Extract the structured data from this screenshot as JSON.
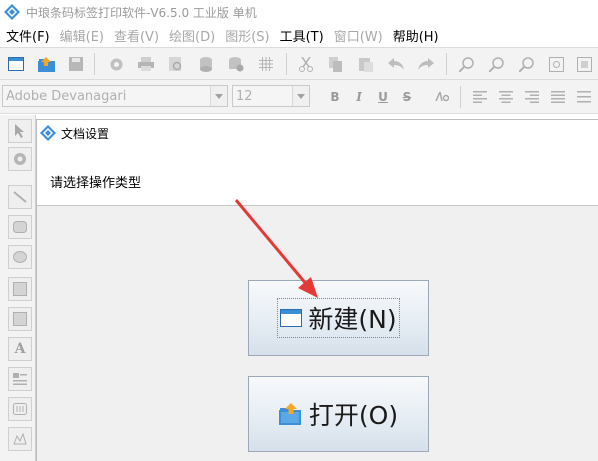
{
  "app": {
    "title": "中琅条码标签打印软件-V6.5.0 工业版 单机",
    "logo_icon": "diamond-logo-icon"
  },
  "menu": [
    {
      "label": "文件(F)",
      "enabled": true
    },
    {
      "label": "编辑(E)",
      "enabled": false
    },
    {
      "label": "查看(V)",
      "enabled": false
    },
    {
      "label": "绘图(D)",
      "enabled": false
    },
    {
      "label": "图形(S)",
      "enabled": false
    },
    {
      "label": "工具(T)",
      "enabled": true
    },
    {
      "label": "窗口(W)",
      "enabled": false
    },
    {
      "label": "帮助(H)",
      "enabled": true
    }
  ],
  "toolbar": {
    "font_name": "Adobe Devanagari",
    "font_size": "12",
    "bold_label": "B",
    "italic_label": "I",
    "underline_label": "U",
    "strike_label": "S"
  },
  "dialog": {
    "title": "文档设置",
    "prompt": "请选择操作类型",
    "new_button": "新建(N)",
    "open_button": "打开(O)"
  },
  "colors": {
    "accent_arrow": "#e53935",
    "button_border": "#9aa8b8"
  }
}
